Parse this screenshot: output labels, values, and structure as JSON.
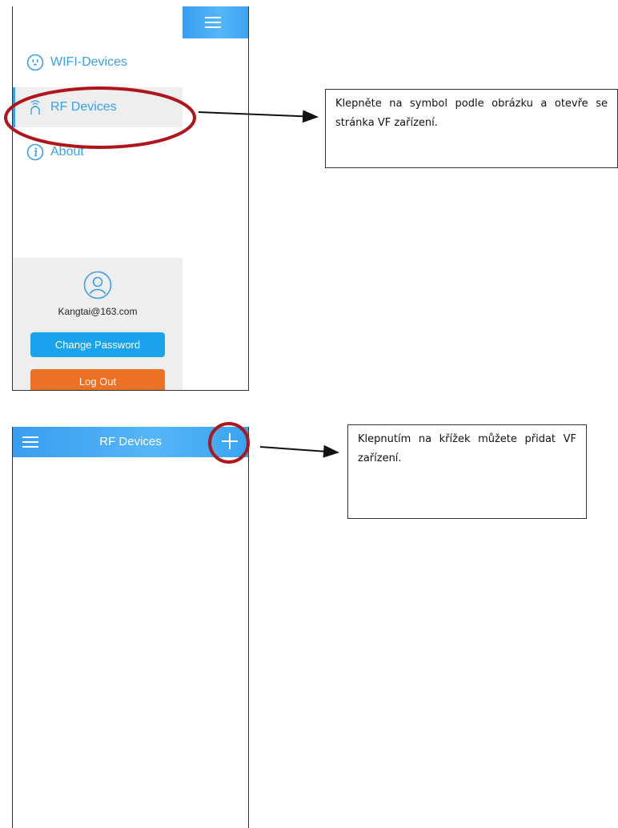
{
  "menu": {
    "items": [
      {
        "label": "WIFI-Devices",
        "icon": "outlet-icon"
      },
      {
        "label": "RF Devices",
        "icon": "rf-signal-icon"
      },
      {
        "label": "About",
        "icon": "info-icon"
      }
    ]
  },
  "user": {
    "email": "Kangtai@163.com",
    "change_password_label": "Change Password",
    "logout_label": "Log Out"
  },
  "rf_page": {
    "title": "RF Devices"
  },
  "callouts": {
    "first": "Klepněte na symbol podle obrázku a otevře se stránka VF zařízení.",
    "second": "Klepnutím na křížek můžete přidat VF zařízení."
  },
  "colors": {
    "accent_blue": "#3aa0e8",
    "button_blue": "#18a3ec",
    "button_orange": "#ec7125",
    "highlight_red": "#b0151c"
  }
}
